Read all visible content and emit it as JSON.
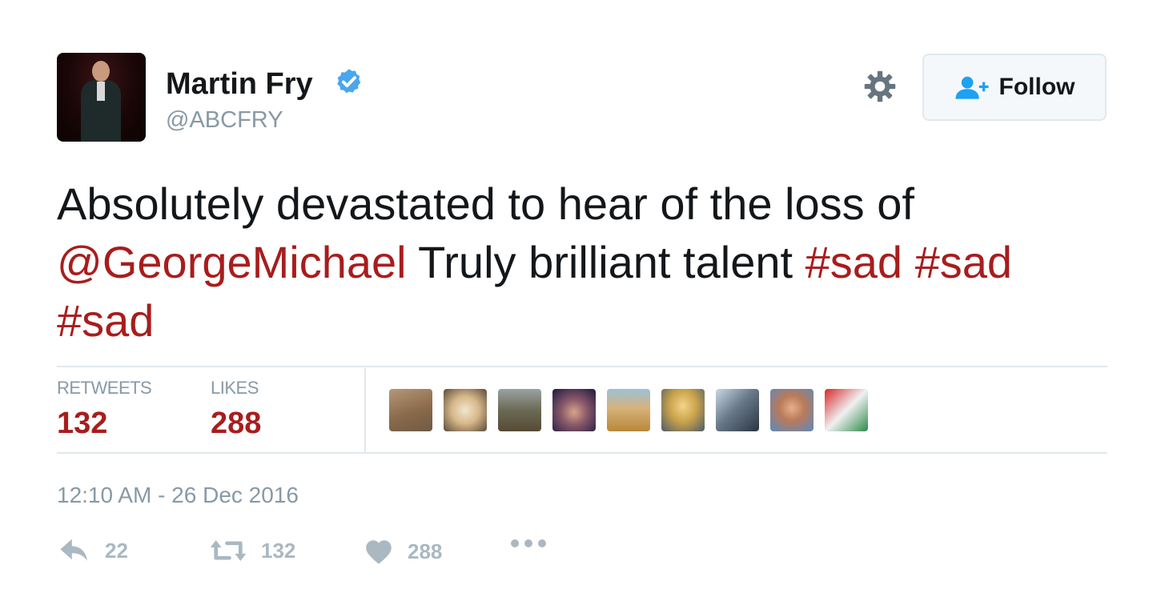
{
  "user": {
    "name": "Martin Fry",
    "handle": "@ABCFRY",
    "verified": true,
    "verified_color": "#4aa6ee"
  },
  "header": {
    "follow_label": "Follow",
    "follow_icon": "add-user-icon",
    "settings_icon": "gear-icon"
  },
  "tweet": {
    "segments": [
      {
        "text": "Absolutely devastated to hear of the loss of ",
        "type": "text"
      },
      {
        "text": "@GeorgeMichael",
        "type": "mention"
      },
      {
        "text": " Truly brilliant talent ",
        "type": "text"
      },
      {
        "text": "#sad",
        "type": "hashtag"
      },
      {
        "text": " ",
        "type": "text"
      },
      {
        "text": "#sad",
        "type": "hashtag"
      },
      {
        "text": " ",
        "type": "text"
      },
      {
        "text": "#sad",
        "type": "hashtag"
      }
    ],
    "link_color": "#a81d1d"
  },
  "stats": {
    "retweets_label": "RETWEETS",
    "retweets_value": "132",
    "likes_label": "LIKES",
    "likes_value": "288"
  },
  "timestamp": "12:10 AM - 26 Dec 2016",
  "actions": {
    "reply": {
      "icon": "reply-icon",
      "count": "22"
    },
    "retweet": {
      "icon": "retweet-icon",
      "count": "132"
    },
    "like": {
      "icon": "heart-icon",
      "count": "288"
    },
    "more": {
      "icon": "more-icon"
    }
  }
}
